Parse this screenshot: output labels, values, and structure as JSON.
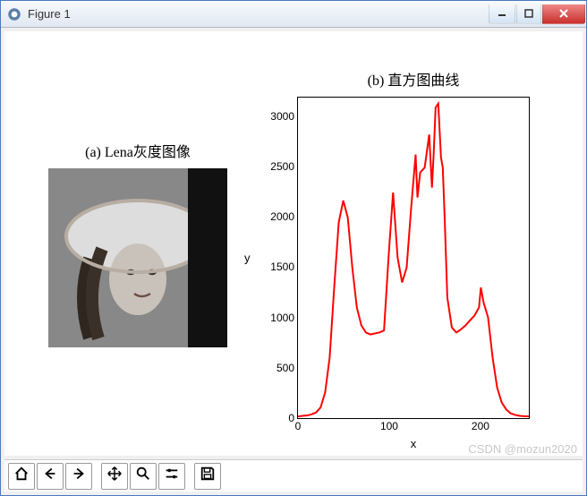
{
  "window": {
    "title": "Figure 1",
    "buttons": {
      "min": "minimize",
      "max": "maximize",
      "close": "close"
    }
  },
  "panels": {
    "left": {
      "title": "(a) Lena灰度图像"
    },
    "right": {
      "title": "(b) 直方图曲线",
      "xlabel": "x",
      "ylabel": "y"
    }
  },
  "chart_data": {
    "type": "line",
    "title": "(b) 直方图曲线",
    "xlabel": "x",
    "ylabel": "y",
    "xlim": [
      0,
      255
    ],
    "ylim": [
      0,
      3200
    ],
    "xticks": [
      0,
      100,
      200
    ],
    "yticks": [
      0,
      500,
      1000,
      1500,
      2000,
      2500,
      3000
    ],
    "color": "#ff0000",
    "x": [
      0,
      5,
      10,
      15,
      20,
      25,
      30,
      35,
      40,
      45,
      50,
      55,
      60,
      65,
      70,
      75,
      80,
      85,
      90,
      95,
      100,
      105,
      110,
      115,
      120,
      125,
      130,
      132,
      135,
      140,
      145,
      148,
      150,
      152,
      155,
      158,
      160,
      162,
      165,
      170,
      175,
      180,
      185,
      190,
      195,
      200,
      202,
      205,
      210,
      215,
      220,
      225,
      230,
      235,
      240,
      245,
      250,
      255
    ],
    "values": [
      10,
      15,
      20,
      30,
      50,
      100,
      250,
      600,
      1300,
      1950,
      2170,
      2000,
      1500,
      1100,
      920,
      850,
      830,
      840,
      850,
      870,
      1600,
      2250,
      1600,
      1350,
      1500,
      2100,
      2630,
      2200,
      2450,
      2500,
      2830,
      2300,
      2650,
      3100,
      3140,
      2600,
      2500,
      2000,
      1200,
      900,
      850,
      880,
      920,
      970,
      1020,
      1100,
      1300,
      1150,
      1000,
      600,
      300,
      150,
      80,
      40,
      25,
      15,
      12,
      10
    ]
  },
  "toolbar": {
    "items": [
      "home",
      "back",
      "forward",
      "pan",
      "zoom",
      "configure",
      "save"
    ]
  },
  "watermark": "CSDN @mozun2020"
}
